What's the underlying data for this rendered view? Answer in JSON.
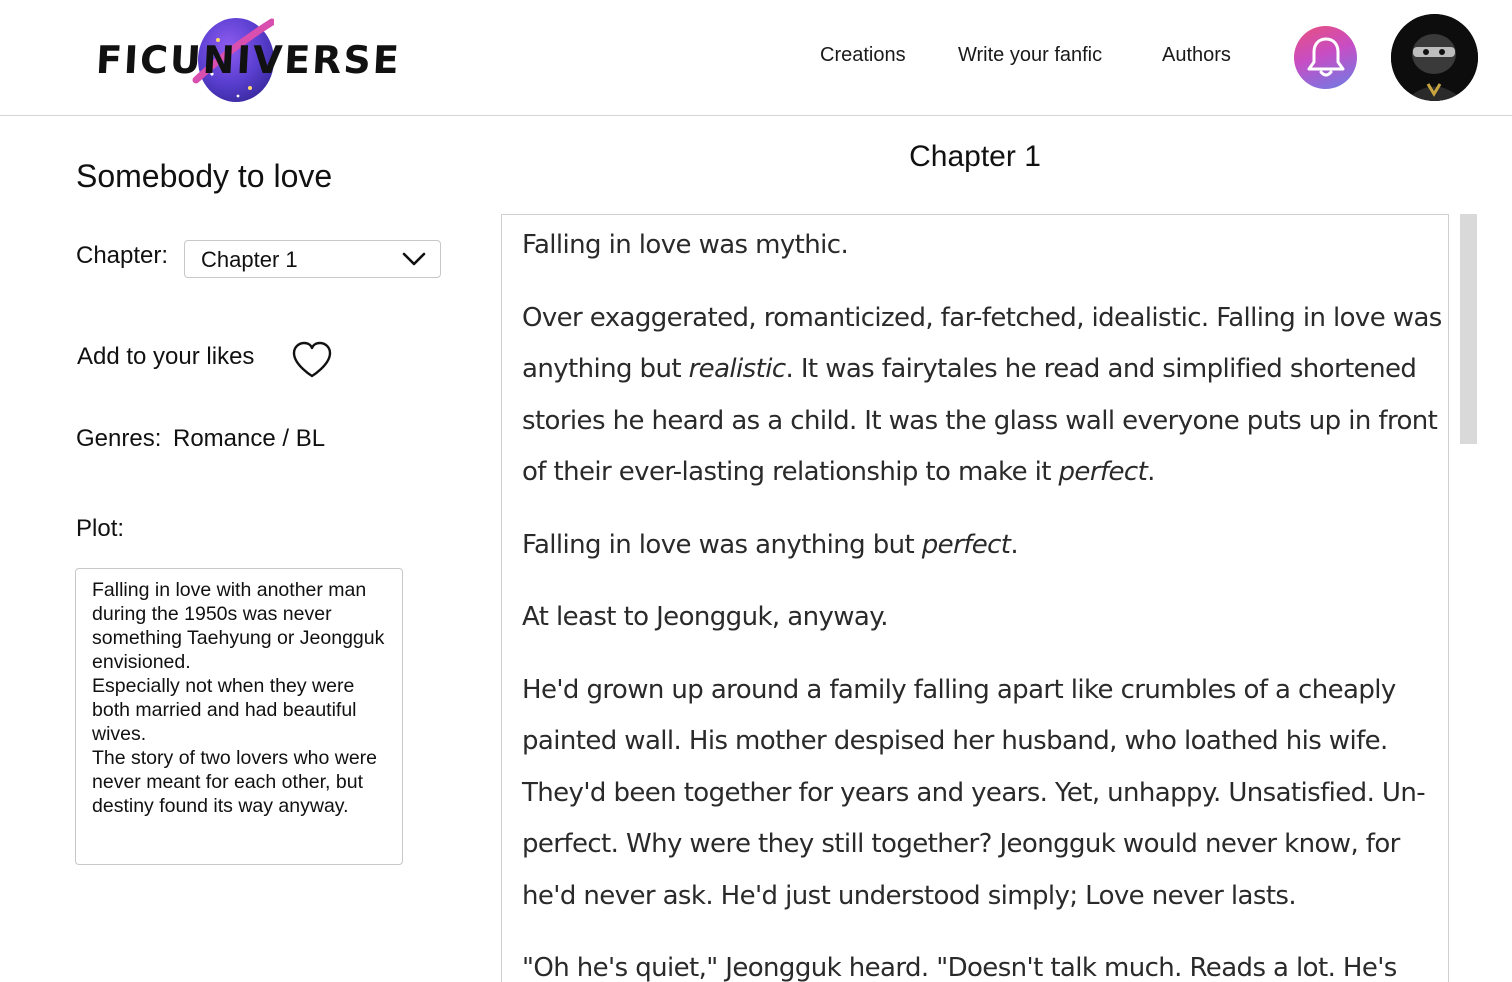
{
  "header": {
    "logo_text": "FICUNIVERSE",
    "nav": {
      "creations": "Creations",
      "write": "Write your fanfic",
      "authors": "Authors"
    },
    "notification_icon": "bell-icon",
    "avatar_icon": "user-avatar"
  },
  "story": {
    "title": "Somebody to love",
    "chapter_label": "Chapter:",
    "chapter_selected": "Chapter 1",
    "likes_label": "Add to your likes",
    "genres_label": "Genres:",
    "genres_value": "Romance / BL",
    "plot_label": "Plot:",
    "plot_text": "Falling in love with another man during the 1950s was never something Taehyung or Jeongguk envisioned.\nEspecially not when they were both married and had beautiful wives.\nThe story of two lovers who were never meant for each other, but destiny found its way anyway."
  },
  "reader": {
    "heading": "Chapter 1",
    "paragraphs": [
      {
        "parts": [
          {
            "t": "Falling in love was mythic."
          }
        ]
      },
      {
        "parts": [
          {
            "t": "Over exaggerated, romanticized, far-fetched, idealistic. Falling in love was anything but "
          },
          {
            "t": "realistic",
            "i": true
          },
          {
            "t": ". It was fairytales he read and simplified shortened stories he heard as a child. It was the glass wall everyone puts up in front of their ever-lasting relationship to make it "
          },
          {
            "t": "perfect",
            "i": true
          },
          {
            "t": "."
          }
        ]
      },
      {
        "parts": [
          {
            "t": "Falling in love was anything but "
          },
          {
            "t": "perfect",
            "i": true
          },
          {
            "t": "."
          }
        ]
      },
      {
        "parts": [
          {
            "t": "At least to Jeongguk, anyway."
          }
        ]
      },
      {
        "parts": [
          {
            "t": "He'd grown up around a family falling apart like crumbles of a cheaply painted wall. His mother despised her husband, who loathed his wife. They'd been together for years and years. Yet, unhappy. Unsatisfied. Un-perfect. Why were they still together? Jeongguk would never know, for he'd never ask. He'd just understood simply; Love never lasts."
          }
        ]
      },
      {
        "parts": [
          {
            "t": "\"Oh he's quiet,\" Jeongguk heard. \"Doesn't talk much. Reads a lot. He's"
          }
        ]
      }
    ]
  }
}
